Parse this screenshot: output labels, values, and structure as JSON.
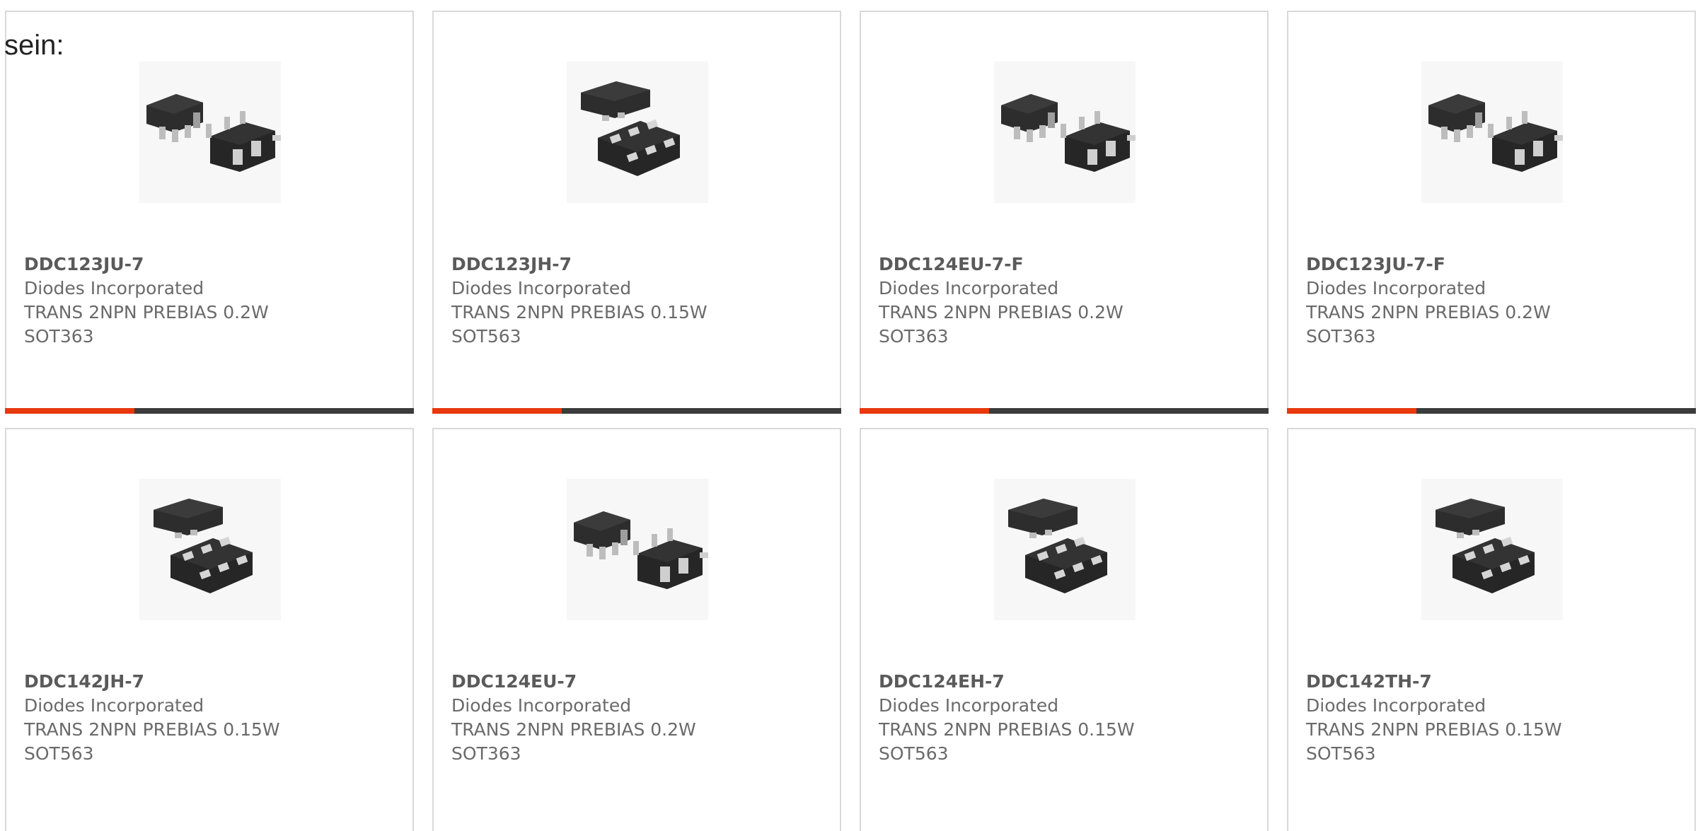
{
  "intro_text": "sein:",
  "colors": {
    "accent": "#e8380d",
    "track": "#3c3c3c",
    "border": "#d9d9d9",
    "text": "#6a6a6a"
  },
  "products": [
    {
      "part": "DDC123JU-7",
      "maker": "Diodes Incorporated",
      "desc": "TRANS 2NPN PREBIAS 0.2W",
      "package": "SOT363",
      "image_icon": "sot363-chip-icon",
      "progress": 0.316
    },
    {
      "part": "DDC123JH-7",
      "maker": "Diodes Incorporated",
      "desc": "TRANS 2NPN PREBIAS 0.15W",
      "package": "SOT563",
      "image_icon": "sot563-chip-icon",
      "progress": 0.316
    },
    {
      "part": "DDC124EU-7-F",
      "maker": "Diodes Incorporated",
      "desc": "TRANS 2NPN PREBIAS 0.2W",
      "package": "SOT363",
      "image_icon": "sot363-chip-icon",
      "progress": 0.316
    },
    {
      "part": "DDC123JU-7-F",
      "maker": "Diodes Incorporated",
      "desc": "TRANS 2NPN PREBIAS 0.2W",
      "package": "SOT363",
      "image_icon": "sot363-chip-icon",
      "progress": 0.316
    },
    {
      "part": "DDC142JH-7",
      "maker": "Diodes Incorporated",
      "desc": "TRANS 2NPN PREBIAS 0.15W",
      "package": "SOT563",
      "image_icon": "sot563-chip-icon"
    },
    {
      "part": "DDC124EU-7",
      "maker": "Diodes Incorporated",
      "desc": "TRANS 2NPN PREBIAS 0.2W",
      "package": "SOT363",
      "image_icon": "sot363-chip-icon"
    },
    {
      "part": "DDC124EH-7",
      "maker": "Diodes Incorporated",
      "desc": "TRANS 2NPN PREBIAS 0.15W",
      "package": "SOT563",
      "image_icon": "sot563-chip-icon"
    },
    {
      "part": "DDC142TH-7",
      "maker": "Diodes Incorporated",
      "desc": "TRANS 2NPN PREBIAS 0.15W",
      "package": "SOT563",
      "image_icon": "sot563-chip-icon"
    }
  ]
}
